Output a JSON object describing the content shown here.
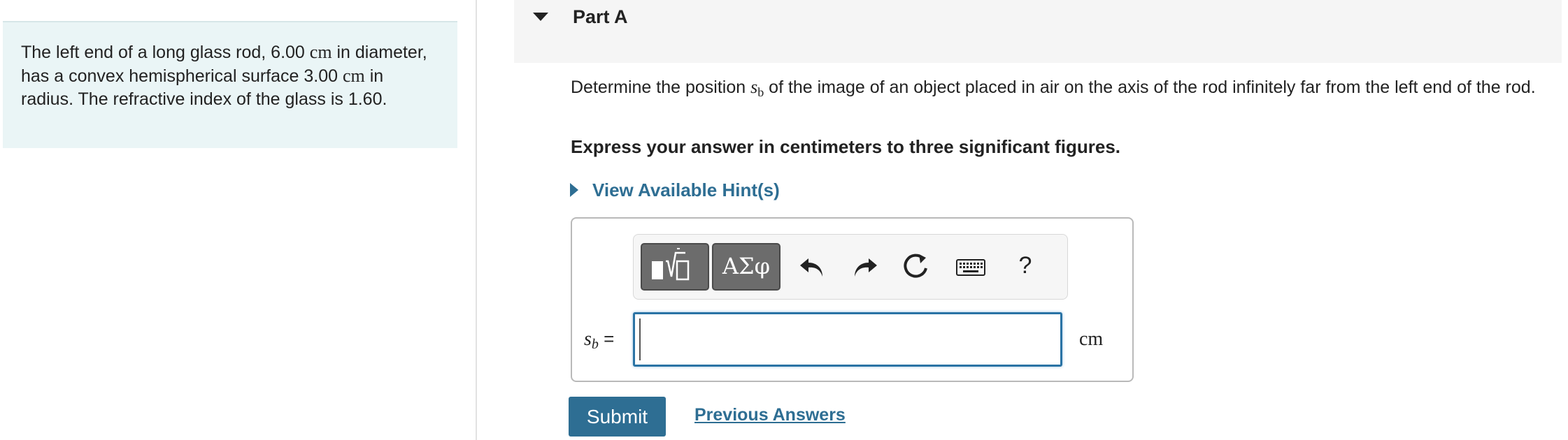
{
  "problem": {
    "t1": "The left end of a long glass rod, 6.00 ",
    "u1": "cm",
    "t2": " in diameter, has a convex hemispherical surface 3.00 ",
    "u2": "cm",
    "t3": " in radius. The refractive index of the glass is 1.60."
  },
  "part": {
    "title": "Part A"
  },
  "question": {
    "before": "Determine the position ",
    "symbol": "s",
    "subscript": "b",
    "after": " of the image of an object placed in air on the axis of the rod infinitely far from the left end of the rod."
  },
  "instruction": "Express your answer in centimeters to three significant figures.",
  "hint": {
    "label": "View Available Hint(s)",
    "icon": "caret-right-icon"
  },
  "toolbar": {
    "greek_label": "ΑΣφ",
    "help_label": "?",
    "icons": [
      "templates-icon",
      "greek-symbols",
      "undo-icon",
      "redo-icon",
      "reset-icon",
      "keyboard-icon",
      "help-icon"
    ]
  },
  "answer": {
    "symbol": "s",
    "subscript": "b",
    "equals": "=",
    "value": "",
    "unit": "cm"
  },
  "submit_label": "Submit",
  "previous_answers_label": "Previous Answers",
  "colors": {
    "accent": "#2e6e93",
    "problem_bg": "#eaf5f6",
    "input_border": "#2a73a5"
  }
}
